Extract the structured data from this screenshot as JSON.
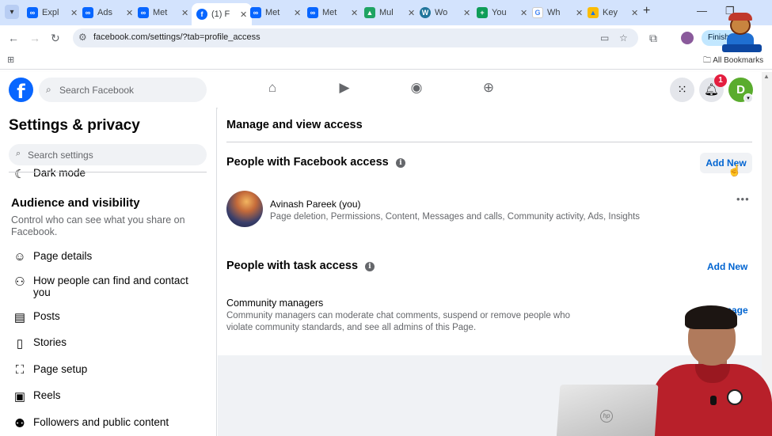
{
  "browser": {
    "tabs": [
      {
        "title": "Expl",
        "favicon": "meta-icon",
        "color": "#0866ff"
      },
      {
        "title": "Ads",
        "favicon": "meta-icon",
        "color": "#0866ff"
      },
      {
        "title": "Met",
        "favicon": "meta-icon",
        "color": "#0866ff"
      },
      {
        "title": "(1) F",
        "favicon": "facebook-icon",
        "color": "#0866ff",
        "active": true
      },
      {
        "title": "Met",
        "favicon": "meta-icon",
        "color": "#0866ff"
      },
      {
        "title": "Met",
        "favicon": "meta-icon",
        "color": "#0866ff"
      },
      {
        "title": "Mul",
        "favicon": "drive-icon",
        "color": "#1fa463"
      },
      {
        "title": "Wo",
        "favicon": "wordpress-icon",
        "color": "#21759b"
      },
      {
        "title": "You",
        "favicon": "sheets-icon",
        "color": "#0f9d58"
      },
      {
        "title": "Wh",
        "favicon": "google-icon",
        "color": "#4285f4"
      },
      {
        "title": "Key",
        "favicon": "ads-icon",
        "color": "#fbbc04"
      }
    ],
    "url": "facebook.com/settings/?tab=profile_access",
    "finish_label": "Finish",
    "all_bookmarks": "All Bookmarks"
  },
  "fb": {
    "search_placeholder": "Search Facebook",
    "notification_count": "1",
    "avatar_letter": "D",
    "brand_color": "#0866ff"
  },
  "sidebar": {
    "title": "Settings & privacy",
    "search_placeholder": "Search settings",
    "partial_item": "Dark mode",
    "section_title": "Audience and visibility",
    "section_desc": "Control who can see what you share on Facebook.",
    "items": [
      {
        "label": "Page details",
        "icon": "person-circle-icon"
      },
      {
        "label": "How people can find and contact you",
        "icon": "people-search-icon"
      },
      {
        "label": "Posts",
        "icon": "posts-icon"
      },
      {
        "label": "Stories",
        "icon": "stories-icon"
      },
      {
        "label": "Page setup",
        "icon": "page-setup-icon"
      },
      {
        "label": "Reels",
        "icon": "reels-icon"
      },
      {
        "label": "Followers and public content",
        "icon": "followers-icon"
      }
    ]
  },
  "main": {
    "title": "Manage and view access",
    "facebook_access": {
      "title": "People with Facebook access",
      "add_new": "Add New",
      "person_name": "Avinash Pareek (you)",
      "permissions": "Page deletion, Permissions, Content, Messages and calls, Community activity, Ads, Insights"
    },
    "task_access": {
      "title": "People with task access",
      "add_new": "Add New",
      "role_title": "Community managers",
      "role_desc": "Community managers can moderate chat comments, suspend or remove people who violate community standards, and see all admins of this Page.",
      "manage": "Manage"
    }
  }
}
